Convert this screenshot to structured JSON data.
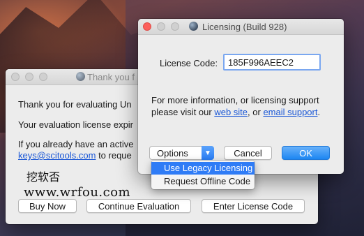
{
  "back_window": {
    "title": "Thank you f",
    "line1": "Thank you for evaluating Un",
    "line2": "Your evaluation license expir",
    "line3": "If you already have an active",
    "email": "keys@scitools.com",
    "line4_suffix": " to reque",
    "buttons": {
      "buy_now": "Buy Now",
      "continue": "Continue Evaluation",
      "enter_code": "Enter License Code"
    }
  },
  "licensing_window": {
    "title": "Licensing (Build 928)",
    "license_label": "License Code:",
    "license_value": "185F996AEEC2",
    "info_line1": "For more information, or licensing support",
    "info_line2_prefix": "please visit our ",
    "web_site_link": "web site",
    "info_line2_mid": ", or ",
    "email_support_link": "email support",
    "info_line2_suffix": ".",
    "options_button": "Options",
    "cancel_button": "Cancel",
    "ok_button": "OK"
  },
  "options_menu": {
    "items": [
      "Use Legacy Licensing",
      "Request Offline Code"
    ],
    "selected": "Use Legacy Licensing"
  },
  "watermark": {
    "line1": "挖软否",
    "line2": "www.wrfou.com"
  },
  "colors": {
    "accent": "#2f7cf6",
    "link": "#1a57d6",
    "close_button": "#fc605c"
  }
}
